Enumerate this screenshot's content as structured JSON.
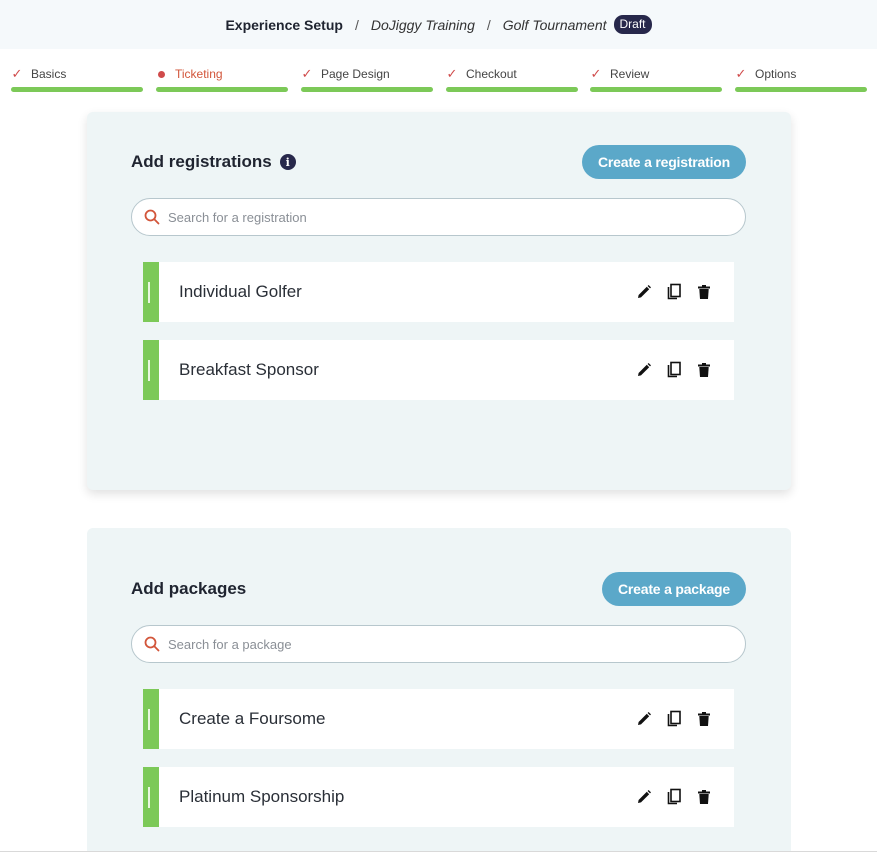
{
  "header": {
    "title": "Experience Setup",
    "breadcrumbs": [
      "DoJiggy Training",
      "Golf Tournament"
    ],
    "status_badge": "Draft"
  },
  "steps": [
    {
      "label": "Basics",
      "state": "complete"
    },
    {
      "label": "Ticketing",
      "state": "current"
    },
    {
      "label": "Page Design",
      "state": "complete"
    },
    {
      "label": "Checkout",
      "state": "complete"
    },
    {
      "label": "Review",
      "state": "complete"
    },
    {
      "label": "Options",
      "state": "complete"
    }
  ],
  "registrations": {
    "title": "Add registrations",
    "create_label": "Create a registration",
    "search_placeholder": "Search for a registration",
    "items": [
      "Individual Golfer",
      "Breakfast Sponsor"
    ]
  },
  "packages": {
    "title": "Add packages",
    "create_label": "Create a package",
    "search_placeholder": "Search for a package",
    "items": [
      "Create a Foursome",
      "Platinum Sponsorship"
    ]
  },
  "colors": {
    "accent_green": "#7cc958",
    "button_blue": "#5ba8c9",
    "badge_navy": "#27284b",
    "active_step": "#d2553a"
  },
  "icons": {
    "item_actions": [
      "pencil-icon",
      "copy-icon",
      "trash-icon"
    ],
    "search": "search-icon",
    "info": "info-icon",
    "step_complete": "checkmark-icon"
  }
}
